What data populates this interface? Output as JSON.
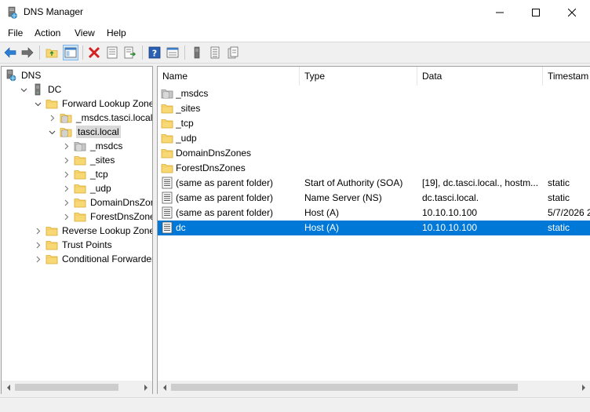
{
  "window": {
    "title": "DNS Manager",
    "minimize_label": "—",
    "maximize_label": "☐",
    "close_label": "✕"
  },
  "menu": [
    "File",
    "Action",
    "View",
    "Help"
  ],
  "toolbar": [
    "back-arrow-icon",
    "forward-arrow-icon",
    "up-folder-icon",
    "show-tree-icon",
    "delete-icon",
    "properties-icon",
    "export-icon",
    "help-icon",
    "console-icon",
    "server-icon",
    "records-icon",
    "copy-icon"
  ],
  "tree": [
    {
      "label": "DNS",
      "icon": "dns-icon",
      "expander": "",
      "depth": 0
    },
    {
      "label": "DC",
      "icon": "server-icon",
      "expander": "v",
      "depth": 1
    },
    {
      "label": "Forward Lookup Zones",
      "icon": "folder-icon",
      "expander": "v",
      "depth": 2
    },
    {
      "label": "_msdcs.tasci.local",
      "icon": "zone-icon",
      "expander": ">",
      "depth": 3
    },
    {
      "label": "tasci.local",
      "icon": "zone-icon",
      "expander": "v",
      "depth": 3,
      "selected": true
    },
    {
      "label": "_msdcs",
      "icon": "grey-zone-icon",
      "expander": ">",
      "depth": 4
    },
    {
      "label": "_sites",
      "icon": "folder-icon",
      "expander": ">",
      "depth": 4
    },
    {
      "label": "_tcp",
      "icon": "folder-icon",
      "expander": ">",
      "depth": 4
    },
    {
      "label": "_udp",
      "icon": "folder-icon",
      "expander": ">",
      "depth": 4
    },
    {
      "label": "DomainDnsZones",
      "icon": "folder-icon",
      "expander": ">",
      "depth": 4
    },
    {
      "label": "ForestDnsZones",
      "icon": "folder-icon",
      "expander": ">",
      "depth": 4
    },
    {
      "label": "Reverse Lookup Zones",
      "icon": "folder-icon",
      "expander": ">",
      "depth": 2
    },
    {
      "label": "Trust Points",
      "icon": "folder-icon",
      "expander": ">",
      "depth": 2
    },
    {
      "label": "Conditional Forwarders",
      "icon": "folder-icon",
      "expander": ">",
      "depth": 2
    }
  ],
  "columns": [
    "Name",
    "Type",
    "Data",
    "Timestam"
  ],
  "rows": [
    {
      "name": "_msdcs",
      "type": "",
      "data": "",
      "timestamp": "",
      "icon": "grey-zone-icon"
    },
    {
      "name": "_sites",
      "type": "",
      "data": "",
      "timestamp": "",
      "icon": "folder-icon"
    },
    {
      "name": "_tcp",
      "type": "",
      "data": "",
      "timestamp": "",
      "icon": "folder-icon"
    },
    {
      "name": "_udp",
      "type": "",
      "data": "",
      "timestamp": "",
      "icon": "folder-icon"
    },
    {
      "name": "DomainDnsZones",
      "type": "",
      "data": "",
      "timestamp": "",
      "icon": "folder-icon"
    },
    {
      "name": "ForestDnsZones",
      "type": "",
      "data": "",
      "timestamp": "",
      "icon": "folder-icon"
    },
    {
      "name": "(same as parent folder)",
      "type": "Start of Authority (SOA)",
      "data": "[19], dc.tasci.local., hostm...",
      "timestamp": "static",
      "icon": "record-icon"
    },
    {
      "name": "(same as parent folder)",
      "type": "Name Server (NS)",
      "data": "dc.tasci.local.",
      "timestamp": "static",
      "icon": "record-icon"
    },
    {
      "name": "(same as parent folder)",
      "type": "Host (A)",
      "data": "10.10.10.100",
      "timestamp": "5/7/2026 2",
      "icon": "record-icon"
    },
    {
      "name": "dc",
      "type": "Host (A)",
      "data": "10.10.10.100",
      "timestamp": "static",
      "icon": "record-icon",
      "selected": true
    }
  ],
  "colors": {
    "selection": "#0078d7",
    "folder": "#f8d775",
    "folder_edge": "#d9a928"
  }
}
